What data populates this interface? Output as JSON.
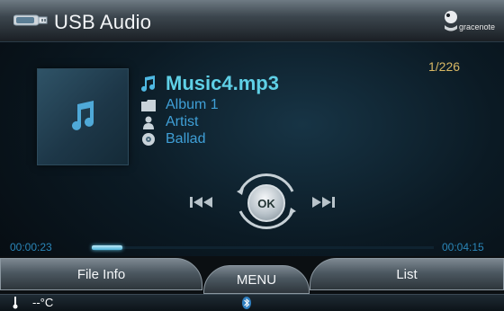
{
  "header": {
    "title": "USB Audio",
    "usb_icon": "usb-drive-icon",
    "brand_text": "gracenote"
  },
  "track": {
    "counter": "1/226",
    "song": "Music4.mp3",
    "album": "Album 1",
    "artist": "Artist",
    "genre": "Ballad"
  },
  "controls": {
    "ok_label": "OK",
    "prev_icon": "previous-track-icon",
    "next_icon": "next-track-icon"
  },
  "progress": {
    "elapsed": "00:00:23",
    "total": "00:04:15",
    "fraction": 0.09
  },
  "bottom": {
    "file_info": "File Info",
    "menu": "MENU",
    "list": "List"
  },
  "status": {
    "temperature": "--°C",
    "bluetooth_icon": "bluetooth-icon"
  },
  "colors": {
    "accent_song": "#5fd0e6",
    "accent_meta": "#3f9fd6",
    "counter": "#d8b864",
    "time": "#2b86b8"
  }
}
